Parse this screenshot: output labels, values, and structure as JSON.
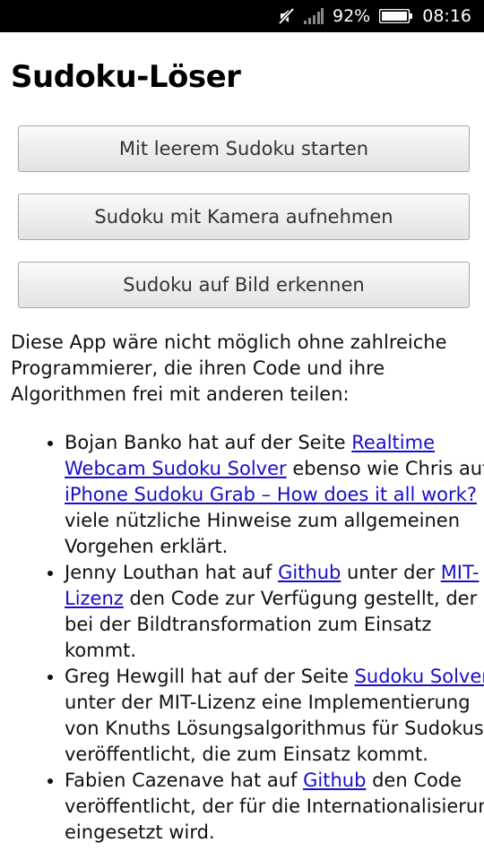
{
  "status_bar": {
    "battery_percent": "92%",
    "time": "08:16",
    "icons": [
      "muted-icon",
      "signal-icon",
      "battery-icon"
    ]
  },
  "title": "Sudoku-Löser",
  "buttons": {
    "empty": "Mit leerem Sudoku starten",
    "camera": "Sudoku mit Kamera aufnehmen",
    "image": "Sudoku auf Bild erkennen"
  },
  "intro": "Diese App wäre nicht möglich ohne zahlreiche Programmierer, die ihren Code und ihre Algorithmen frei mit anderen teilen:",
  "credits": [
    {
      "t1": "Bojan Banko hat auf der Seite ",
      "l1": "Realtime Webcam Sudoku Solver",
      "t2": " ebenso wie Chris auf ",
      "l2": "iPhone Sudoku Grab – How does it all work?",
      "t3": " viele nützliche Hinweise zum allgemeinen Vorgehen erklärt."
    },
    {
      "t1": "Jenny Louthan hat auf ",
      "l1": "Github",
      "t2": " unter der ",
      "l2": "MIT-Lizenz",
      "t3": " den Code zur Verfügung gestellt, der bei der Bildtransformation zum Einsatz kommt."
    },
    {
      "t1": "Greg Hewgill hat auf der Seite ",
      "l1": "Sudoku Solver",
      "t2": " unter der MIT-Lizenz eine Implementierung von Knuths Lösungsalgorithmus für Sudokus veröffentlicht, die zum Einsatz kommt."
    },
    {
      "t1": "Fabien Cazenave hat auf ",
      "l1": "Github",
      "t2": " den Code veröffentlicht, der für die Internationalisierung eingesetzt wird."
    }
  ],
  "colors": {
    "link": "#1a0dcc",
    "status_bar_bg": "#000000"
  }
}
